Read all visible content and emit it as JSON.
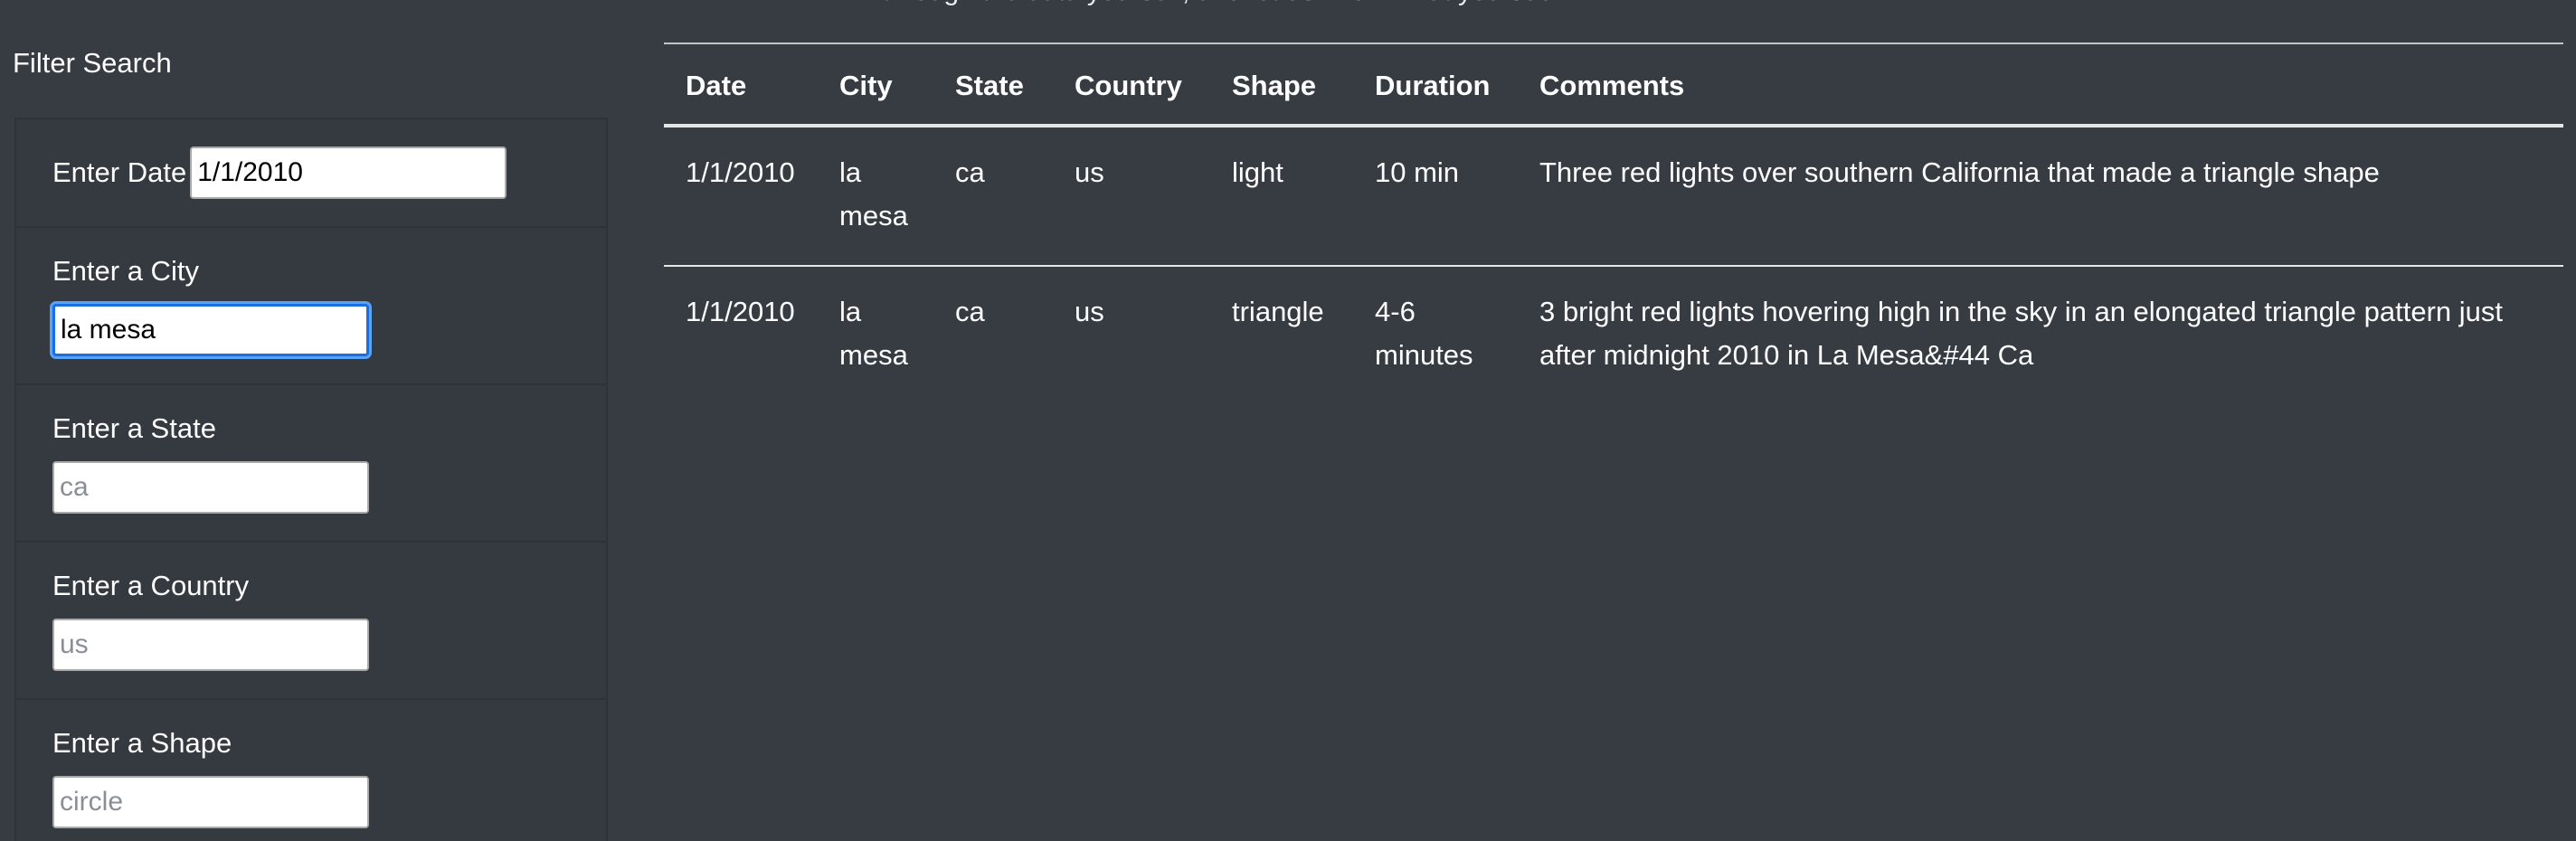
{
  "intro": {
    "text": "through the data yourself, and let us know what you see."
  },
  "filters": {
    "title": "Filter Search",
    "date": {
      "label": "Enter Date",
      "value": "1/1/2010",
      "placeholder": ""
    },
    "city": {
      "label": "Enter a City",
      "value": "la mesa",
      "placeholder": ""
    },
    "state": {
      "label": "Enter a State",
      "value": "",
      "placeholder": "ca"
    },
    "country": {
      "label": "Enter a Country",
      "value": "",
      "placeholder": "us"
    },
    "shape": {
      "label": "Enter a Shape",
      "value": "",
      "placeholder": "circle"
    }
  },
  "table": {
    "headers": {
      "date": "Date",
      "city": "City",
      "state": "State",
      "country": "Country",
      "shape": "Shape",
      "duration": "Duration",
      "comments": "Comments"
    },
    "rows": [
      {
        "date": "1/1/2010",
        "city": "la mesa",
        "state": "ca",
        "country": "us",
        "shape": "light",
        "duration": "10 min",
        "comments": "Three red lights over southern California that made a triangle shape"
      },
      {
        "date": "1/1/2010",
        "city": "la mesa",
        "state": "ca",
        "country": "us",
        "shape": "triangle",
        "duration": "4-6 minutes",
        "comments": "3 bright red lights hovering high in the sky in an elongated triangle pattern just after midnight 2010 in La Mesa&#44 Ca"
      }
    ]
  }
}
